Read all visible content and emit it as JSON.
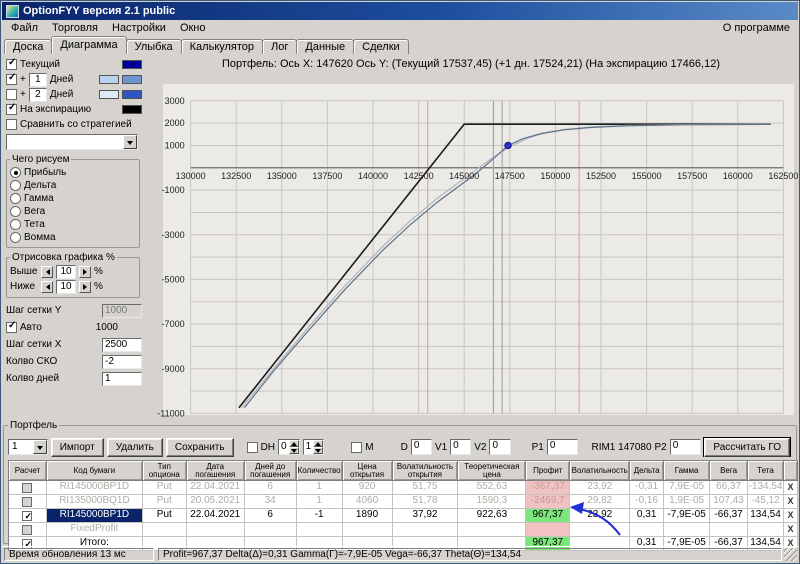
{
  "window": {
    "title": "OptionFYY версия 2.1 public"
  },
  "menu": {
    "items": [
      "Файл",
      "Торговля",
      "Настройки",
      "Окно"
    ],
    "right": "О программе"
  },
  "tabs": {
    "items": [
      "Доска",
      "Диаграмма",
      "Улыбка",
      "Калькулятор",
      "Лог",
      "Данные",
      "Сделки"
    ],
    "active": "Диаграмма"
  },
  "sidebar": {
    "current_label": "Текущий",
    "plus1": {
      "prefix": "+",
      "value": "1",
      "suffix": "Дней"
    },
    "plus2": {
      "prefix": "+",
      "value": "2",
      "suffix": "Дней"
    },
    "expiry_label": "На экспирацию",
    "compare_label": "Сравнить со стратегией",
    "colors": {
      "current": "#000099",
      "plus1": [
        "#b9d3ee",
        "#6f94cd"
      ],
      "plus2": [
        "#dce9f7",
        "#2f55c0"
      ],
      "expiry": "#000000"
    },
    "draw_group": {
      "title": "Чего рисуем",
      "options": [
        "Прибыль",
        "Дельта",
        "Гамма",
        "Вега",
        "Тета",
        "Вомма"
      ],
      "selected": "Прибыль"
    },
    "range_group": {
      "title": "Отрисовка графика %",
      "above": "Выше",
      "above_value": "10",
      "below": "Ниже",
      "below_value": "10",
      "unit": "%"
    },
    "grid_y": {
      "label": "Шаг сетки Y",
      "value": "1000"
    },
    "auto": {
      "label": "Авто",
      "value": "1000"
    },
    "grid_x": {
      "label": "Шаг сетки X",
      "value": "2500"
    },
    "sko": {
      "label": "Колво СКО",
      "value": "-2"
    },
    "days": {
      "label": "Колво дней",
      "value": "1"
    }
  },
  "chart": {
    "title": "Портфель: Ось X: 147620 Ось Y:  (Текущий 17537,45)  (+1 дн. 17524,21)  (На экспирацию 17466,12)"
  },
  "chart_data": {
    "type": "line",
    "x_range": [
      127500,
      163300
    ],
    "y_range": [
      -11250,
      4200
    ],
    "x_ticks": [
      130000,
      132500,
      135000,
      137500,
      140000,
      142500,
      145000,
      147500,
      150000,
      152500,
      155000,
      157500,
      160000,
      162500
    ],
    "y_labels": [
      3000,
      2000,
      1000,
      -1000,
      -3000,
      -5000,
      -7000,
      -9000,
      -11000
    ],
    "grid_top": 3000,
    "grid_bottom": -11000,
    "y_grid_step": 1000,
    "vlines_gray": [
      146600,
      147080
    ],
    "vlines_red": [
      143000,
      151300
    ],
    "series": [
      {
        "name": "На экспирацию",
        "color": "#1c1c1c",
        "width": 1.6,
        "points": [
          [
            132650,
            -10750
          ],
          [
            145000,
            1950
          ],
          [
            161800,
            1950
          ]
        ]
      },
      {
        "name": "+1 дн.",
        "color": "#aab6c2",
        "width": 1.2,
        "points": [
          [
            132800,
            -10750
          ],
          [
            134500,
            -9050
          ],
          [
            136500,
            -7100
          ],
          [
            138500,
            -5250
          ],
          [
            140500,
            -3550
          ],
          [
            142000,
            -2400
          ],
          [
            143500,
            -1380
          ],
          [
            144500,
            -780
          ],
          [
            145500,
            -180
          ],
          [
            146500,
            420
          ],
          [
            147500,
            950
          ],
          [
            148500,
            1330
          ],
          [
            149500,
            1580
          ],
          [
            150500,
            1720
          ],
          [
            152000,
            1830
          ],
          [
            154000,
            1900
          ],
          [
            157000,
            1935
          ],
          [
            161800,
            1950
          ]
        ]
      },
      {
        "name": "Текущий",
        "color": "#5f7187",
        "width": 1.2,
        "points": [
          [
            132950,
            -10750
          ],
          [
            134500,
            -9150
          ],
          [
            136500,
            -7250
          ],
          [
            138500,
            -5420
          ],
          [
            140500,
            -3720
          ],
          [
            142000,
            -2580
          ],
          [
            143500,
            -1560
          ],
          [
            144500,
            -950
          ],
          [
            145500,
            -350
          ],
          [
            146200,
            120
          ],
          [
            147000,
            700
          ],
          [
            147400,
            1000
          ],
          [
            148200,
            1300
          ],
          [
            149200,
            1530
          ],
          [
            150500,
            1700
          ],
          [
            152000,
            1810
          ],
          [
            154000,
            1880
          ],
          [
            157000,
            1925
          ],
          [
            161800,
            1945
          ]
        ]
      }
    ],
    "marker": {
      "x": 147400,
      "y": 1000,
      "color": "#2a35c8"
    }
  },
  "portfolio": {
    "title": "Портфель",
    "controls": {
      "combo_value": "1",
      "import": "Импорт",
      "delete": "Удалить",
      "save": "Сохранить",
      "dh": "DH",
      "spin1": "0",
      "spin2": "1",
      "m": "M",
      "d_label": "D",
      "d_value": "0",
      "v1_label": "V1",
      "v1_value": "0",
      "v2_label": "V2",
      "v2_value": "0",
      "p1_label": "P1",
      "p1_value": "0",
      "instrument": "RIM1 147080",
      "p2_label": "P2",
      "p2_value": "0",
      "calc_button": "Рассчитать ГО"
    },
    "table": {
      "headers": [
        "Расчет",
        "Код бумаги",
        "Тип опциона",
        "Дата погашения",
        "Дней до погашения",
        "Количество",
        "Цена открытия",
        "Волатильность открытия",
        "Теоретическая цена",
        "Профит",
        "Волатильность",
        "Дельта",
        "Гамма",
        "Вега",
        "Тета",
        ""
      ],
      "rows": [
        {
          "checked": false,
          "disabled": true,
          "selected": false,
          "profit_color": "pink",
          "cells": [
            "RI145000BP1D",
            "Put",
            "22.04.2021",
            "6",
            "1",
            "920",
            "51,75",
            "552,63",
            "-367,37",
            "23,92",
            "-0,31",
            "7,9E-05",
            "66,37",
            "-134,54"
          ],
          "close": "X"
        },
        {
          "checked": false,
          "disabled": true,
          "selected": false,
          "profit_color": "pink",
          "cells": [
            "RI135000BQ1D",
            "Put",
            "20.05.2021",
            "34",
            "1",
            "4060",
            "51,78",
            "1590,3",
            "-2469,7",
            "29,82",
            "-0,16",
            "1,9E-05",
            "107,43",
            "-45,12"
          ],
          "close": "X"
        },
        {
          "checked": true,
          "disabled": false,
          "selected": true,
          "profit_color": "green",
          "cells": [
            "RI145000BP1D",
            "Put",
            "22.04.2021",
            "6",
            "-1",
            "1890",
            "37,92",
            "922,63",
            "967,37",
            "23,92",
            "0,31",
            "-7,9E-05",
            "-66,37",
            "134,54"
          ],
          "close": "X"
        },
        {
          "checked": false,
          "disabled": true,
          "selected": false,
          "profit_color": "pink",
          "cells": [
            "FixedProfit",
            "",
            "",
            "",
            "",
            "",
            "",
            "",
            "",
            "",
            "",
            "",
            "",
            ""
          ],
          "close": "X"
        },
        {
          "checked": true,
          "disabled": false,
          "selected": false,
          "profit_color": "green",
          "cells": [
            "Итого:",
            "",
            "",
            "",
            "",
            "",
            "",
            "",
            "967,37",
            "",
            "0,31",
            "-7,9E-05",
            "-66,37",
            "134,54"
          ],
          "close": "X"
        }
      ]
    }
  },
  "statusbar": {
    "left": "Время обновления 13 мс",
    "right": "Profit=967,37 Delta(Δ)=0,31 Gamma(Γ)=-7,9E-05 Vega=-66,37 Theta(Θ)=134,54"
  }
}
